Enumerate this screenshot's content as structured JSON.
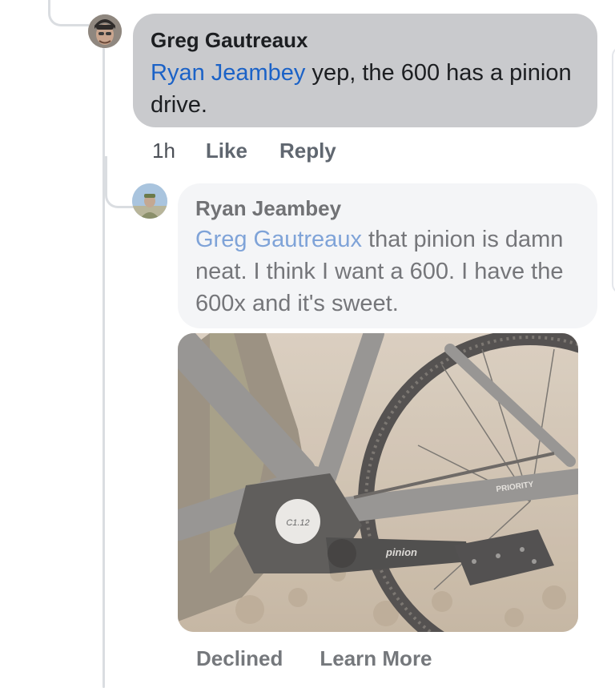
{
  "comments": [
    {
      "author": "Greg Gautreaux",
      "mention": "Ryan Jeambey",
      "text": " yep, the 600 has a pinion drive.",
      "actions": {
        "time": "1h",
        "like": "Like",
        "reply": "Reply"
      }
    },
    {
      "author": "Ryan Jeambey",
      "mention": "Greg Gautreaux",
      "text": " that pinion is damn neat. I think I want a 600. I have the 600x and it's sweet.",
      "photo": {
        "bike_brand": "PRIORITY",
        "gearbox_label": "C1.12",
        "crank_label": "pinion"
      },
      "actions": {
        "declined": "Declined",
        "learn_more": "Learn More"
      }
    }
  ]
}
